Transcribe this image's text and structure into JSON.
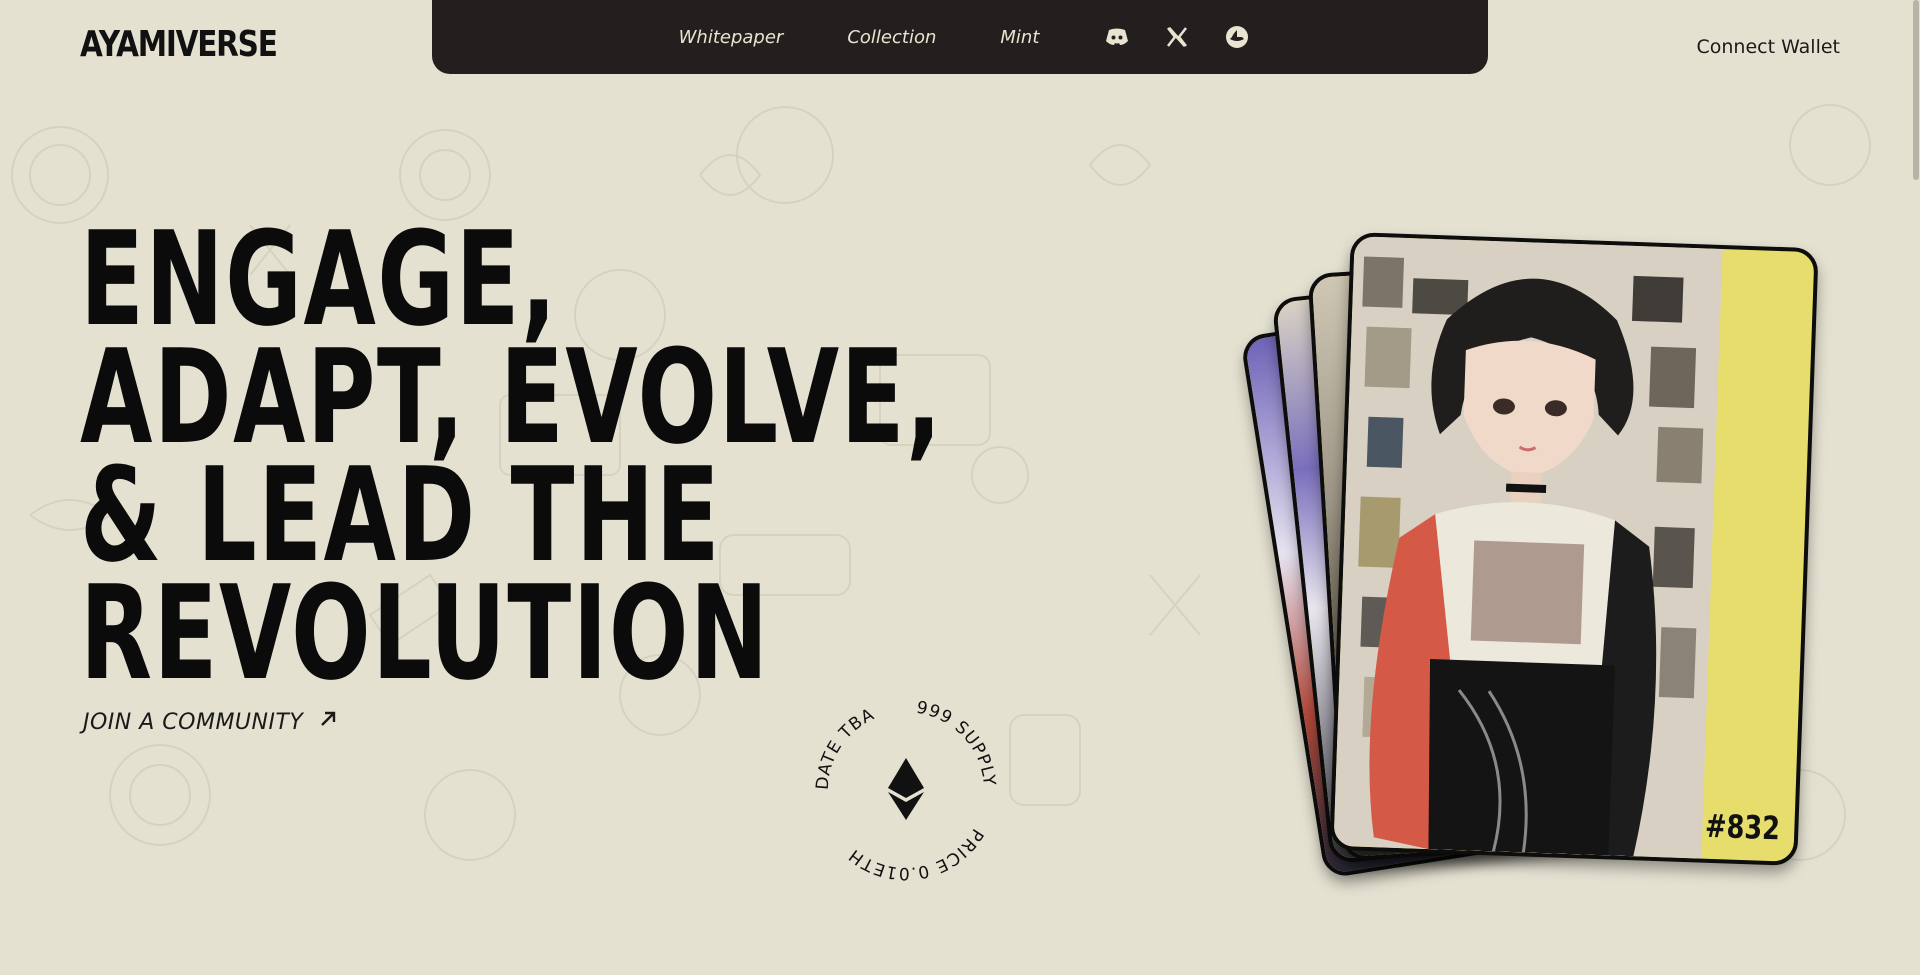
{
  "brand": {
    "logo_text": "AYAMIVERSE"
  },
  "nav": {
    "links": [
      "Whitepaper",
      "Collection",
      "Mint"
    ],
    "social_icons": [
      "discord-icon",
      "x-twitter-icon",
      "opensea-icon"
    ]
  },
  "header": {
    "connect_label": "Connect Wallet"
  },
  "hero": {
    "headline_lines": [
      "ENGAGE,",
      "ADAPT, EVOLVE,",
      "& LEAD THE",
      "REVOLUTION"
    ],
    "cta_label": "JOIN A COMMUNITY"
  },
  "badge": {
    "top_left": "DATE TBA",
    "top_right": "999 SUPPLY",
    "bottom": "PRICE 0.01ETH",
    "center_icon": "ethereum-icon"
  },
  "card": {
    "token_number": "#832",
    "accent_color": "#e6dd6c"
  },
  "colors": {
    "background": "#e4e1d1",
    "topbar": "#231f1f",
    "nav_text": "#e9e4cf"
  }
}
